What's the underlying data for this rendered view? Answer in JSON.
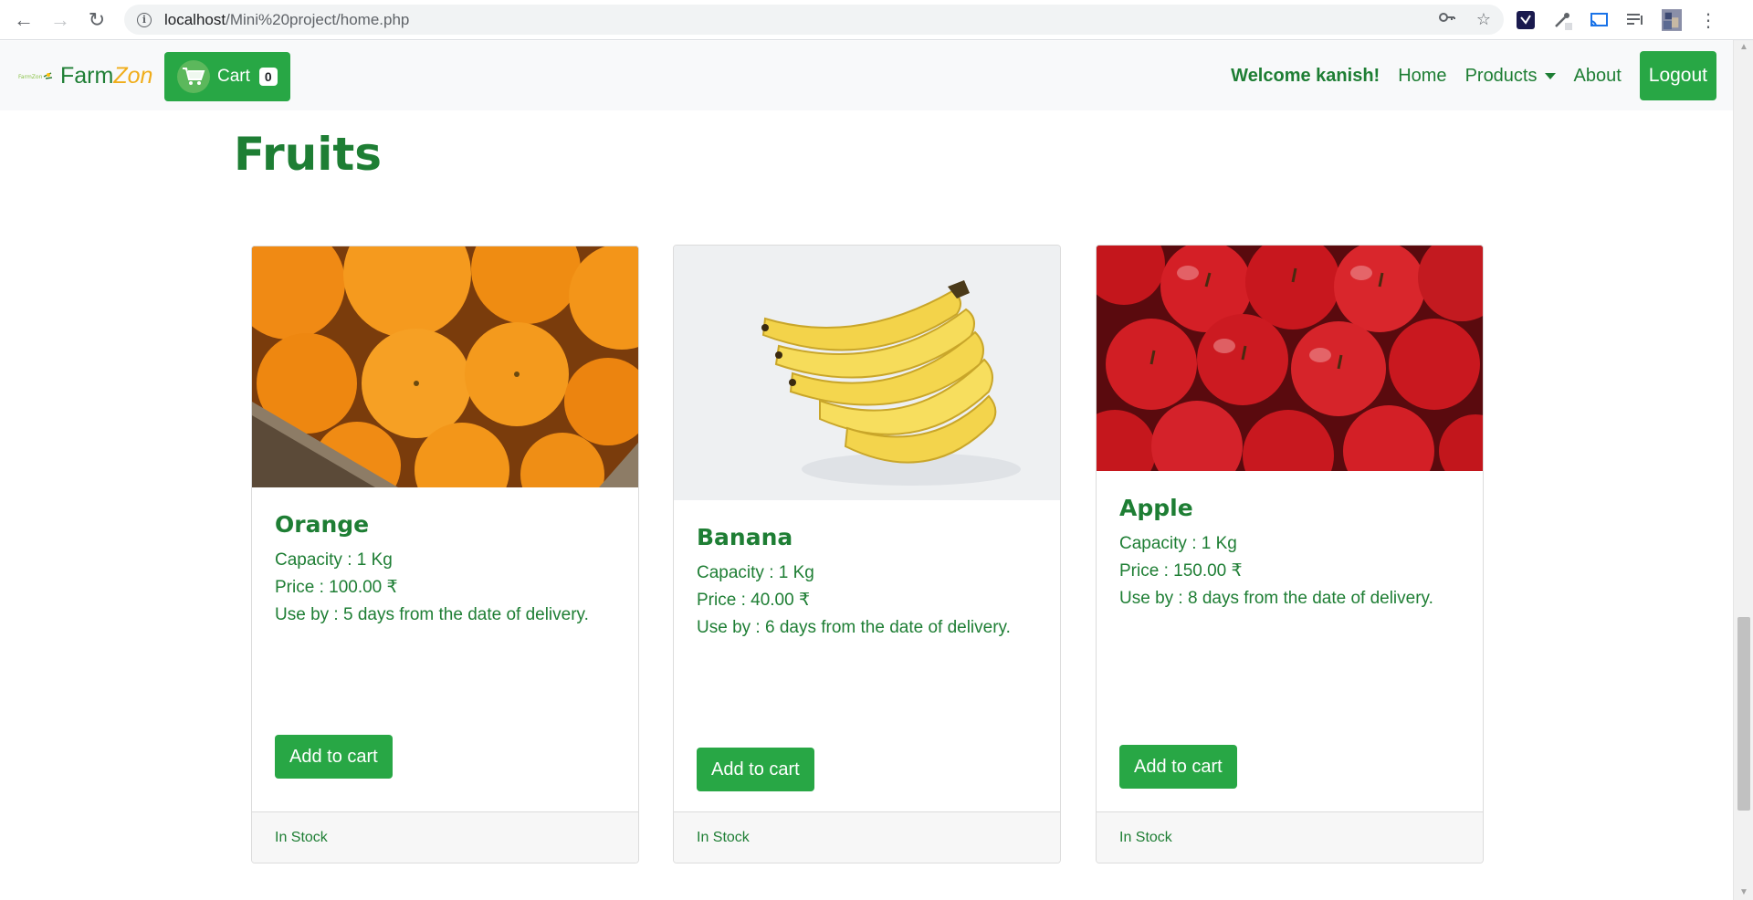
{
  "browser": {
    "url_host": "localhost",
    "url_path": "/Mini%20project/home.php"
  },
  "navbar": {
    "brand_prefix": "Farm",
    "brand_suffix": "Zon",
    "logo_text": "FarmZon",
    "cart_label": "Cart",
    "cart_count": "0",
    "welcome": "Welcome kanish!",
    "links": {
      "home": "Home",
      "products": "Products",
      "about": "About"
    },
    "logout": "Logout"
  },
  "page": {
    "title": "Fruits"
  },
  "products": [
    {
      "name": "Orange",
      "capacity": "Capacity : 1 Kg",
      "price": "Price : 100.00 ₹",
      "use_by": "Use by : 5 days from the date of delivery.",
      "button": "Add to cart",
      "status": "In Stock"
    },
    {
      "name": "Banana",
      "capacity": "Capacity : 1 Kg",
      "price": "Price : 40.00 ₹",
      "use_by": "Use by : 6 days from the date of delivery.",
      "button": "Add to cart",
      "status": "In Stock"
    },
    {
      "name": "Apple",
      "capacity": "Capacity : 1 Kg",
      "price": "Price : 150.00 ₹",
      "use_by": "Use by : 8 days from the date of delivery.",
      "button": "Add to cart",
      "status": "In Stock"
    }
  ],
  "colors": {
    "brand_green": "#1e7e34",
    "button_green": "#28a745",
    "brand_accent": "#f0ad1a"
  }
}
